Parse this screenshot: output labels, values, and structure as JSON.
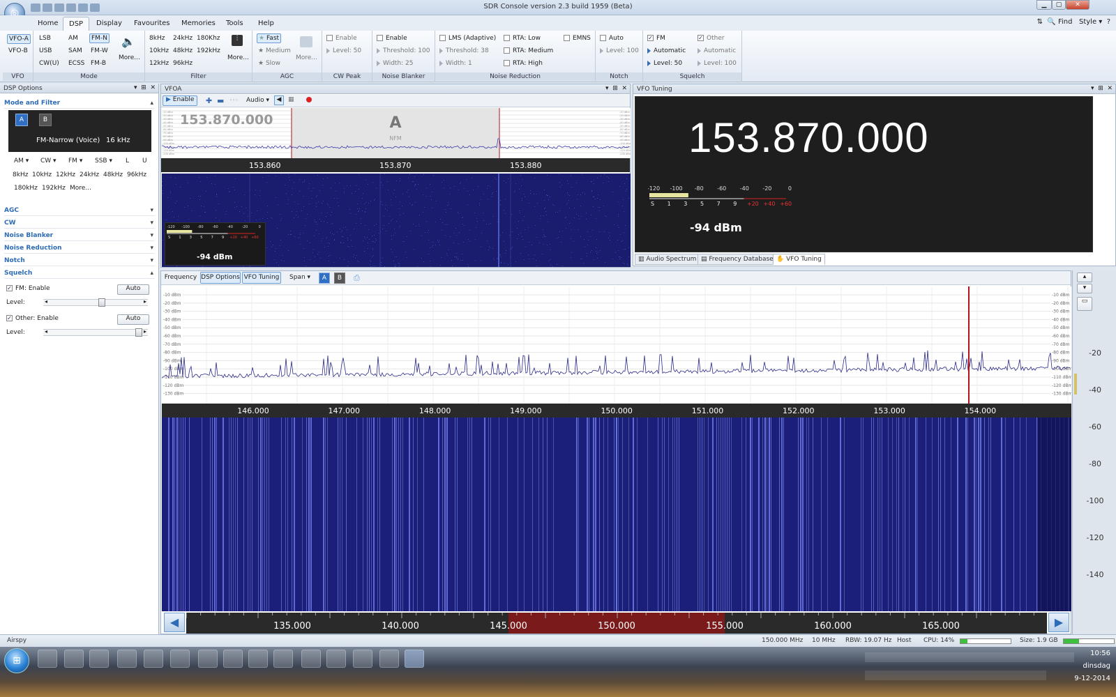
{
  "window": {
    "title": "SDR Console version 2.3 build 1959 (Beta)",
    "min": "▁",
    "max": "▢",
    "close": "✕"
  },
  "menu": {
    "tabs": [
      "Home",
      "DSP",
      "Display",
      "Favourites",
      "Memories",
      "Tools",
      "Help"
    ],
    "active": 1,
    "find": "Find",
    "style": "Style"
  },
  "ribbon": {
    "vfo": {
      "label": "VFO",
      "items": [
        "VFO-A",
        "VFO-B"
      ]
    },
    "mode": {
      "label": "Mode",
      "col1": [
        "LSB",
        "USB",
        "CW(U)"
      ],
      "col2": [
        "AM",
        "SAM",
        "ECSS"
      ],
      "col3": [
        "FM-N",
        "FM-W",
        "FM-B"
      ],
      "more": "More..."
    },
    "filter": {
      "label": "Filter",
      "col1": [
        "8kHz",
        "10kHz",
        "12kHz"
      ],
      "col2": [
        "24kHz",
        "48kHz",
        "96kHz"
      ],
      "col3": [
        "180Khz",
        "192kHz"
      ],
      "more": "More..."
    },
    "agc": {
      "label": "AGC",
      "items": [
        "Fast",
        "Medium",
        "Slow"
      ],
      "more": "More..."
    },
    "cwpeak": {
      "label": "CW Peak",
      "enable": "Enable",
      "level": "Level: 50"
    },
    "nb": {
      "label": "Noise Blanker",
      "enable": "Enable",
      "threshold": "Threshold: 100",
      "width": "Width: 25"
    },
    "nr": {
      "label": "Noise Reduction",
      "lms": "LMS (Adaptive)",
      "threshold": "Threshold: 38",
      "width": "Width: 1",
      "rta_low": "RTA: Low",
      "rta_med": "RTA: Medium",
      "rta_high": "RTA: High",
      "emns": "EMNS"
    },
    "notch": {
      "label": "Notch",
      "auto": "Auto",
      "level": "Level: 100"
    },
    "squelch": {
      "label": "Squelch",
      "fm": "FM",
      "automatic": "Automatic",
      "level": "Level: 50",
      "other": "Other",
      "automatic2": "Automatic",
      "level2": "Level: 100"
    }
  },
  "dsp_options": {
    "title": "DSP Options",
    "mode_filter": "Mode and Filter",
    "vfo_a": "A",
    "vfo_b": "B",
    "mode_text": "FM-Narrow (Voice)",
    "bw_text": "16 kHz",
    "mode_buttons": [
      "AM",
      "CW",
      "FM",
      "SSB",
      "L",
      "U"
    ],
    "filters_row1": [
      "8kHz",
      "10kHz",
      "12kHz",
      "24kHz",
      "48kHz",
      "96kHz"
    ],
    "filters_row2": [
      "180kHz",
      "192kHz",
      "More..."
    ],
    "sections": [
      "AGC",
      "CW",
      "Noise Blanker",
      "Noise Reduction",
      "Notch",
      "Squelch"
    ],
    "fm_enable": "FM: Enable",
    "other_enable": "Other: Enable",
    "auto": "Auto",
    "level": "Level:",
    "fm_level": 0.58,
    "other_level": 0.97
  },
  "vfoa": {
    "title": "VFOA",
    "enable": "Enable",
    "audio": "Audio",
    "freq": "153.870.000",
    "marker": "A",
    "marker_sub": "NFM",
    "ticks": [
      "153.860",
      "153.870",
      "153.880"
    ],
    "smeter_scale": [
      "-120",
      "-100",
      "-80",
      "-60",
      "-40",
      "-20",
      "0"
    ],
    "smeter_s": [
      "S",
      "1",
      "3",
      "5",
      "7",
      "9"
    ],
    "smeter_plus": [
      "+20",
      "+40",
      "+60"
    ],
    "dbm": "-94 dBm",
    "db_labels": [
      "-10 dBm",
      "-20 dBm",
      "-30 dBm",
      "-40 dBm",
      "-50 dBm",
      "-60 dBm",
      "-70 dBm",
      "-80 dBm",
      "-90 dBm",
      "-100 dBm",
      "-110 dBm",
      "-120 dBm",
      "-130 dBm"
    ]
  },
  "vfo_tuning": {
    "title": "VFO Tuning",
    "freq": "153.870.000",
    "scale": [
      "-120",
      "-100",
      "-80",
      "-60",
      "-40",
      "-20",
      "0"
    ],
    "s_units": [
      "S",
      "1",
      "3",
      "5",
      "7",
      "9"
    ],
    "plus": [
      "+20",
      "+40",
      "+60"
    ],
    "dbm": "-94 dBm",
    "tabs": [
      "Audio Spectrum",
      "Frequency Database",
      "VFO Tuning"
    ]
  },
  "main": {
    "toolbar": [
      "Frequency",
      "DSP Options",
      "VFO Tuning"
    ],
    "span": "Span",
    "a": "A",
    "b": "B",
    "db_labels": [
      "-10 dBm",
      "-20 dBm",
      "-30 dBm",
      "-40 dBm",
      "-50 dBm",
      "-60 dBm",
      "-70 dBm",
      "-80 dBm",
      "-90 dBm",
      "-100 dBm",
      "-110 dBm",
      "-120 dBm",
      "-130 dBm"
    ],
    "ticks": [
      "146.000",
      "147.000",
      "148.000",
      "149.000",
      "150.000",
      "151.000",
      "152.000",
      "153.000",
      "154.000"
    ],
    "overview_ticks": [
      "135.000",
      "140.000",
      "145.000",
      "150.000",
      "155.000",
      "160.000",
      "165.000"
    ],
    "right_scale": [
      "-20",
      "-40",
      "-60",
      "-80",
      "-100",
      "-120",
      "-140"
    ]
  },
  "status": {
    "device": "Airspy",
    "center": "150.000 MHz",
    "bw": "10 MHz",
    "rbw": "RBW: 19.07 Hz",
    "host": "Host",
    "cpu": "CPU: 14%",
    "size": "Size: 1.9 GB",
    "cpu_level": 0.14,
    "size_level": 0.3
  },
  "taskbar": {
    "time": "10:56",
    "day": "dinsdag",
    "date": "9-12-2014"
  },
  "colors": {
    "accent": "#2c6bb5",
    "waterfall": "#1c1f7a",
    "spectrum_line": "#2a2a8a",
    "red_marker": "#b3121b"
  }
}
